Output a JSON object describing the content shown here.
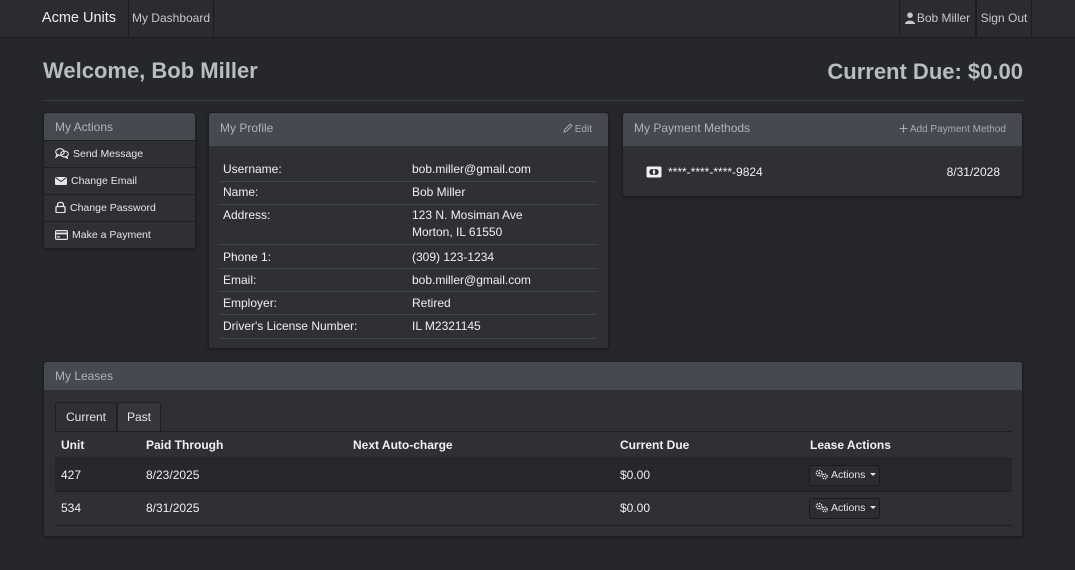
{
  "navbar": {
    "brand": "Acme Units",
    "dashboard_link": "My Dashboard",
    "user_name": "Bob Miller",
    "sign_out": "Sign Out",
    "user_icon": "user-icon"
  },
  "header": {
    "welcome": "Welcome, Bob Miller",
    "current_due": "Current Due: $0.00"
  },
  "actions": {
    "title": "My Actions",
    "items": [
      {
        "label": "Send Message",
        "icon": "chat-icon"
      },
      {
        "label": "Change Email",
        "icon": "envelope-icon"
      },
      {
        "label": "Change Password",
        "icon": "lock-icon"
      },
      {
        "label": "Make a Payment",
        "icon": "credit-card-icon"
      }
    ]
  },
  "profile": {
    "title": "My Profile",
    "edit_label": "Edit",
    "edit_icon": "pencil-icon",
    "rows": [
      {
        "label": "Username:",
        "value": "bob.miller@gmail.com"
      },
      {
        "label": "Name:",
        "value": "Bob Miller"
      },
      {
        "label": "Address:",
        "value": "123 N. Mosiman Ave",
        "value2": "Morton, IL 61550"
      },
      {
        "label": "Phone 1:",
        "value": "(309) 123-1234"
      },
      {
        "label": "Email:",
        "value": "bob.miller@gmail.com"
      },
      {
        "label": "Employer:",
        "value": "Retired"
      },
      {
        "label": "Driver's License Number:",
        "value": "IL M2321145"
      }
    ]
  },
  "payment": {
    "title": "My Payment Methods",
    "add_label": "Add Payment Method",
    "add_icon": "plus-icon",
    "card": {
      "icon": "mastercard-icon",
      "number": "****-****-****-9824",
      "expiration": "8/31/2028"
    }
  },
  "leases": {
    "title": "My Leases",
    "tabs": [
      "Current",
      "Past"
    ],
    "active_tab": "Current",
    "columns": [
      "Unit",
      "Paid Through",
      "Next Auto-charge",
      "Current Due",
      "Lease Actions"
    ],
    "rows": [
      {
        "unit": "427",
        "paid_through": "8/23/2025",
        "next_autocharge": "",
        "current_due": "$0.00",
        "action_label": "Actions"
      },
      {
        "unit": "534",
        "paid_through": "8/31/2025",
        "next_autocharge": "",
        "current_due": "$0.00",
        "action_label": "Actions"
      }
    ],
    "action_icon": "gears-icon"
  }
}
